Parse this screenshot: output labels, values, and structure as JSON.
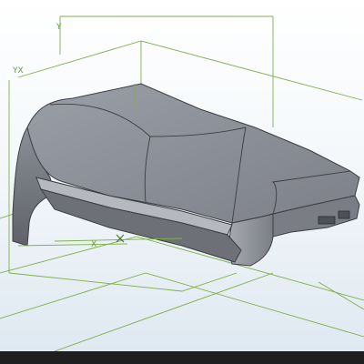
{
  "viewport": {
    "background_top": "#ffffff",
    "background_bottom": "#dfe9f1",
    "grid_line_color": "#7fb04a",
    "part_color": "#8a8d94"
  },
  "axis_labels": {
    "top_left": "Y",
    "left": "YX",
    "bottom_marker": "X"
  },
  "bottom_bar": {
    "color": "#1f1f1f"
  }
}
